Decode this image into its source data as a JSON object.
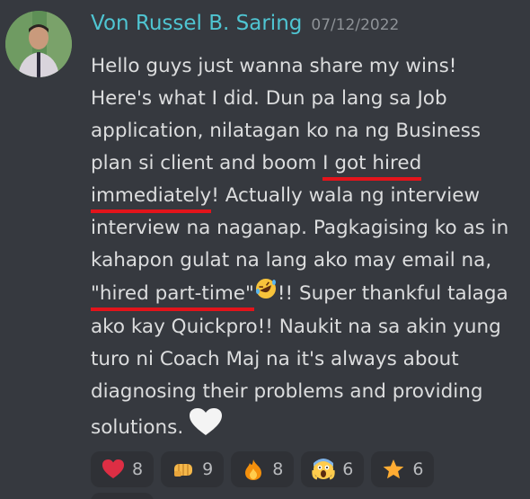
{
  "post": {
    "username": "Von Russel B. Saring",
    "timestamp": "07/12/2022",
    "message": {
      "t1": "Hello guys just wanna share my wins! Here's what I did. Dun pa lang sa Job application, nilatagan ko na ng Business plan si client and boom ",
      "ul1": "I got hired",
      "t2": " ",
      "ul2": "immediately",
      "t3": "! Actually wala ng interview interview na naganap. Pagkagising ko as in kahapon gulat na lang ako may email na, ",
      "ul3": "\"hired part-time\"",
      "t4": "!! Super thankful talaga ako kay Quickpro!! Naukit na sa akin yung turo ni Coach Maj na it's always about diagnosing their problems and providing solutions. "
    }
  },
  "reactions": [
    {
      "icon": "red-heart-icon",
      "count": "8"
    },
    {
      "icon": "punch-fist-icon",
      "count": "9"
    },
    {
      "icon": "fire-icon",
      "count": "8"
    },
    {
      "icon": "screaming-face-icon",
      "count": "6"
    },
    {
      "icon": "star-icon",
      "count": "6"
    }
  ],
  "colors": {
    "background": "#36393f",
    "username": "#4fc5d2",
    "timestamp": "#8e9297",
    "text": "#dcddde",
    "underline": "#e3141b",
    "reaction_bg": "#2f3136"
  }
}
